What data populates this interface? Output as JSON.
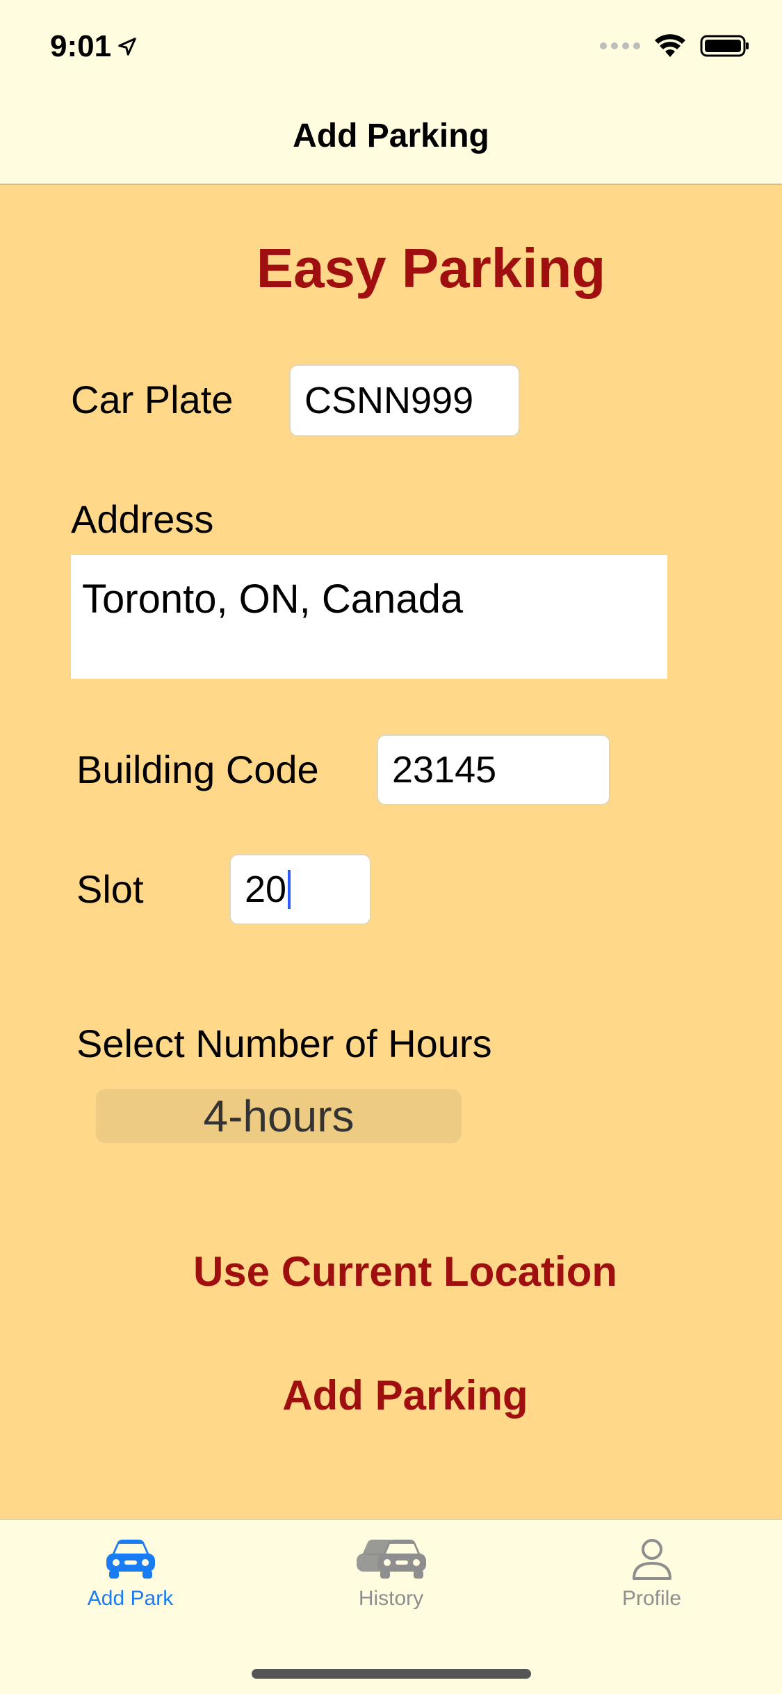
{
  "status": {
    "time": "9:01"
  },
  "nav": {
    "title": "Add Parking"
  },
  "form": {
    "app_title": "Easy Parking",
    "car_plate_label": "Car Plate",
    "car_plate_value": "CSNN999",
    "address_label": "Address",
    "address_value": "Toronto, ON, Canada",
    "building_code_label": "Building Code",
    "building_code_value": "23145",
    "slot_label": "Slot",
    "slot_value": "20",
    "hours_label": "Select Number of Hours",
    "hours_selected": "4-hours"
  },
  "actions": {
    "use_location": "Use Current Location",
    "add_parking": "Add Parking"
  },
  "tabs": [
    {
      "label": "Add Park",
      "icon": "car-icon",
      "active": true
    },
    {
      "label": "History",
      "icon": "cars-history-icon",
      "active": false
    },
    {
      "label": "Profile",
      "icon": "person-icon",
      "active": false
    }
  ],
  "colors": {
    "background": "#FFD88A",
    "bar_background": "#FFFCE0",
    "accent_red": "#A00F0F",
    "tab_active": "#1A7CF2",
    "tab_inactive": "#8E8E8E"
  }
}
